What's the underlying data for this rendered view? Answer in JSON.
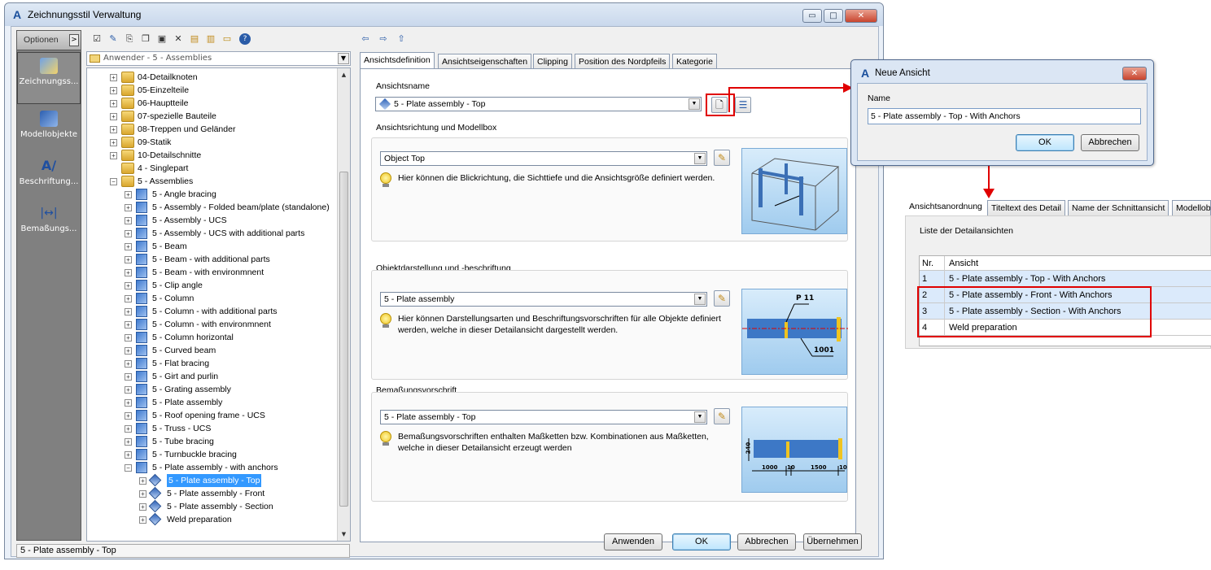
{
  "window": {
    "title": "Zeichnungsstil Verwaltung",
    "minimize": "▭",
    "maximize": "□",
    "close": "✕"
  },
  "sidebar": {
    "options_label": "Optionen",
    "items": [
      {
        "label": "Zeichnungss...",
        "icon": "drawing-style-icon",
        "active": true
      },
      {
        "label": "Modellobjekte",
        "icon": "model-objects-icon",
        "active": false
      },
      {
        "label": "Beschriftung...",
        "icon": "labeling-icon",
        "active": false
      },
      {
        "label": "Bemaßungs...",
        "icon": "dimensioning-icon",
        "active": false
      }
    ]
  },
  "toolbar": {
    "nav_back": "⇦",
    "nav_forward": "⇨",
    "nav_up": "⇧"
  },
  "tree": {
    "combo_value": "Anwender - 5 - Assemblies",
    "rows": [
      {
        "label": "04-Detailknoten",
        "level": 0,
        "icon": "folder",
        "exp": "+"
      },
      {
        "label": "05-Einzelteile",
        "level": 0,
        "icon": "folder",
        "exp": "+"
      },
      {
        "label": "06-Hauptteile",
        "level": 0,
        "icon": "folder",
        "exp": "+"
      },
      {
        "label": "07-spezielle Bauteile",
        "level": 0,
        "icon": "folder",
        "exp": "+"
      },
      {
        "label": "08-Treppen und Geländer",
        "level": 0,
        "icon": "folder",
        "exp": "+"
      },
      {
        "label": "09-Statik",
        "level": 0,
        "icon": "folder",
        "exp": "+"
      },
      {
        "label": "10-Detailschnitte",
        "level": 0,
        "icon": "folder",
        "exp": "+"
      },
      {
        "label": "4 - Singlepart",
        "level": 0,
        "icon": "folder",
        "exp": ""
      },
      {
        "label": "5 - Assemblies",
        "level": 0,
        "icon": "folder",
        "exp": "−"
      },
      {
        "label": "5 - Angle bracing",
        "level": 1,
        "icon": "cube",
        "exp": "+"
      },
      {
        "label": "5 - Assembly - Folded beam/plate (standalone)",
        "level": 1,
        "icon": "cube",
        "exp": "+"
      },
      {
        "label": "5 - Assembly - UCS",
        "level": 1,
        "icon": "cube",
        "exp": "+"
      },
      {
        "label": "5 - Assembly - UCS with additional parts",
        "level": 1,
        "icon": "cube",
        "exp": "+"
      },
      {
        "label": "5 - Beam",
        "level": 1,
        "icon": "cube",
        "exp": "+"
      },
      {
        "label": "5 - Beam - with additional parts",
        "level": 1,
        "icon": "cube",
        "exp": "+"
      },
      {
        "label": "5 - Beam - with environmnent",
        "level": 1,
        "icon": "cube",
        "exp": "+"
      },
      {
        "label": "5 - Clip angle",
        "level": 1,
        "icon": "cube",
        "exp": "+"
      },
      {
        "label": "5 - Column",
        "level": 1,
        "icon": "cube",
        "exp": "+"
      },
      {
        "label": "5 - Column - with additional parts",
        "level": 1,
        "icon": "cube",
        "exp": "+"
      },
      {
        "label": "5 - Column - with environmnent",
        "level": 1,
        "icon": "cube",
        "exp": "+"
      },
      {
        "label": "5 - Column horizontal",
        "level": 1,
        "icon": "cube",
        "exp": "+"
      },
      {
        "label": "5 - Curved beam",
        "level": 1,
        "icon": "cube",
        "exp": "+"
      },
      {
        "label": "5 - Flat bracing",
        "level": 1,
        "icon": "cube",
        "exp": "+"
      },
      {
        "label": "5 - Girt and purlin",
        "level": 1,
        "icon": "cube",
        "exp": "+"
      },
      {
        "label": "5 - Grating assembly",
        "level": 1,
        "icon": "cube",
        "exp": "+"
      },
      {
        "label": "5 - Plate assembly",
        "level": 1,
        "icon": "cube",
        "exp": "+"
      },
      {
        "label": "5 - Roof opening frame - UCS",
        "level": 1,
        "icon": "cube",
        "exp": "+"
      },
      {
        "label": "5 - Truss - UCS",
        "level": 1,
        "icon": "cube",
        "exp": "+"
      },
      {
        "label": "5 - Tube bracing",
        "level": 1,
        "icon": "cube",
        "exp": "+"
      },
      {
        "label": "5 - Turnbuckle bracing",
        "level": 1,
        "icon": "cube",
        "exp": "+"
      },
      {
        "label": "5 - Plate assembly - with anchors",
        "level": 1,
        "icon": "cube",
        "exp": "−"
      },
      {
        "label": "5 - Plate assembly - Top",
        "level": 2,
        "icon": "diamond",
        "exp": "+",
        "selected": true
      },
      {
        "label": "5 - Plate assembly - Front",
        "level": 2,
        "icon": "diamond",
        "exp": "+"
      },
      {
        "label": "5 - Plate assembly - Section",
        "level": 2,
        "icon": "diamond",
        "exp": "+"
      },
      {
        "label": "Weld preparation",
        "level": 2,
        "icon": "diamond",
        "exp": "+"
      }
    ]
  },
  "status": {
    "text": "5 - Plate assembly - Top"
  },
  "tabs": [
    "Ansichtsdefinition",
    "Ansichtseigenschaften",
    "Clipping",
    "Position des Nordpfeils",
    "Kategorie"
  ],
  "content": {
    "view_name_label": "Ansichtsname",
    "view_name_value": "5 - Plate assembly - Top",
    "group1": {
      "title": "Ansichtsrichtung und Modellbox",
      "combo": "Object Top",
      "hint": "Hier können die Blickrichtung, die Sichttiefe und die Ansichtsgröße definiert werden."
    },
    "group2": {
      "title": "Objektdarstellung und -beschriftung",
      "combo": "5 - Plate assembly",
      "hint": "Hier können Darstellungsarten und Beschriftungsvorschriften für alle Objekte definiert werden, welche in dieser Detailansicht dargestellt werden.",
      "pic_labels": [
        "P 11",
        "1001"
      ]
    },
    "group3": {
      "title": "Bemaßungsvorschrift",
      "combo": "5 - Plate assembly - Top",
      "hint": "Bemaßungsvorschriften enthalten Maßketten bzw. Kombinationen aus Maßketten, welche in dieser Detailansicht erzeugt werden",
      "pic_labels": [
        "240",
        "1000",
        "10",
        "1500",
        "10"
      ]
    }
  },
  "buttons": {
    "apply": "Anwenden",
    "ok": "OK",
    "cancel": "Abbrechen",
    "accept": "Übernehmen"
  },
  "dialog": {
    "title": "Neue Ansicht",
    "name_label": "Name",
    "name_value": "5 - Plate assembly - Top - With Anchors",
    "ok": "OK",
    "cancel": "Abbrechen"
  },
  "listpanel": {
    "tabs": [
      "Ansichtsanordnung",
      "Titeltext des Detail",
      "Name der Schnittansicht",
      "Modellobj"
    ],
    "group_title": "Liste der Detailansichten",
    "columns": [
      "Nr.",
      "Ansicht"
    ],
    "rows": [
      {
        "nr": "1",
        "name": "5 - Plate assembly - Top - With Anchors",
        "highlight": true
      },
      {
        "nr": "2",
        "name": "5 - Plate assembly - Front - With Anchors",
        "highlight": true
      },
      {
        "nr": "3",
        "name": "5 - Plate assembly - Section - With Anchors",
        "highlight": true
      },
      {
        "nr": "4",
        "name": "Weld preparation",
        "highlight": false
      }
    ]
  },
  "colors": {
    "highlight_red": "#e00000",
    "selection_blue": "#3399ff",
    "row_highlight": "#dbeafb"
  }
}
